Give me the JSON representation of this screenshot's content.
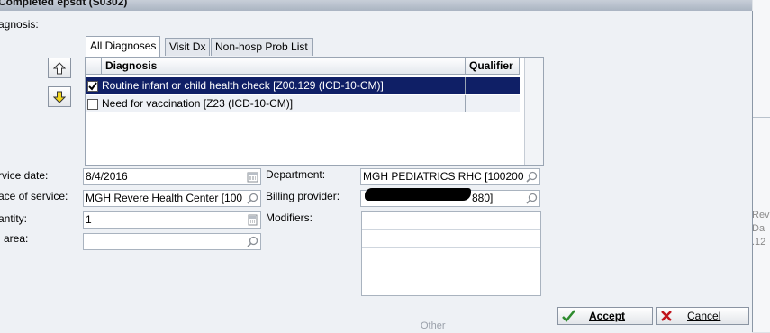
{
  "window": {
    "title": "Completed epsdt (S0302)"
  },
  "labels": {
    "diagnosis": "agnosis:",
    "service_date": "rvice date:",
    "place_of_service": "ace of service:",
    "quantity": "antity:",
    "area": "l area:",
    "department": "Department:",
    "billing_provider": "Billing provider:",
    "modifiers": "Modifiers:"
  },
  "tabs": [
    {
      "label": "All Diagnoses"
    },
    {
      "label": "Visit Dx"
    },
    {
      "label": "Non-hosp Prob List"
    }
  ],
  "grid": {
    "headers": {
      "diagnosis": "Diagnosis",
      "qualifier": "Qualifier"
    },
    "rows": [
      {
        "checked": true,
        "diagnosis": "Routine infant or child health check [Z00.129 (ICD-10-CM)]",
        "qualifier": ""
      },
      {
        "checked": false,
        "diagnosis": "Need for vaccination [Z23 (ICD-10-CM)]",
        "qualifier": ""
      }
    ]
  },
  "fields": {
    "service_date": "8/4/2016",
    "place_of_service": "MGH Revere Health Center [100",
    "quantity": "1",
    "area": "",
    "department": "MGH PEDIATRICS RHC [100200",
    "billing_provider_suffix": "880]"
  },
  "buttons": {
    "accept": "Accept",
    "cancel": "Cancel"
  },
  "background_text": {
    "line1": "Reve",
    "line2": "Da",
    "line3": ".12",
    "other": "Other"
  },
  "colors": {
    "selection": "#0f1f66",
    "accent_green": "#2e8b2e",
    "cancel_red": "#c0141c"
  }
}
